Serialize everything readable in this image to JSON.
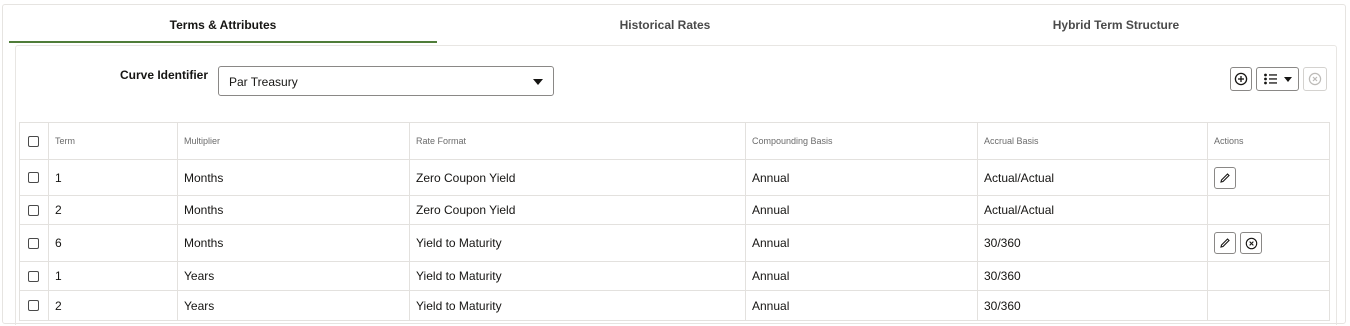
{
  "tabs": [
    {
      "label": "Terms & Attributes",
      "active": true
    },
    {
      "label": "Historical Rates",
      "active": false
    },
    {
      "label": "Hybrid Term Structure",
      "active": false
    }
  ],
  "curve": {
    "label": "Curve Identifier",
    "value": "Par Treasury"
  },
  "toolbar": {
    "add_icon": "plus-circle-icon",
    "view_icon": "list-view-icon",
    "remove_icon": "close-circle-icon",
    "remove_disabled": true
  },
  "table": {
    "headers": [
      "Term",
      "Multiplier",
      "Rate Format",
      "Compounding Basis",
      "Accrual Basis",
      "Actions"
    ],
    "rows": [
      {
        "term": "1",
        "multiplier": "Months",
        "rate_format": "Zero Coupon Yield",
        "compounding": "Annual",
        "accrual": "Actual/Actual",
        "actions": [
          "edit"
        ]
      },
      {
        "term": "2",
        "multiplier": "Months",
        "rate_format": "Zero Coupon Yield",
        "compounding": "Annual",
        "accrual": "Actual/Actual",
        "actions": []
      },
      {
        "term": "6",
        "multiplier": "Months",
        "rate_format": "Yield to Maturity",
        "compounding": "Annual",
        "accrual": "30/360",
        "actions": [
          "edit",
          "delete"
        ]
      },
      {
        "term": "1",
        "multiplier": "Years",
        "rate_format": "Yield to Maturity",
        "compounding": "Annual",
        "accrual": "30/360",
        "actions": []
      },
      {
        "term": "2",
        "multiplier": "Years",
        "rate_format": "Yield to Maturity",
        "compounding": "Annual",
        "accrual": "30/360",
        "actions": []
      }
    ]
  },
  "colors": {
    "active_tab_underline": "#4f7d39",
    "border": "#e3e1de",
    "text": "#161513"
  }
}
